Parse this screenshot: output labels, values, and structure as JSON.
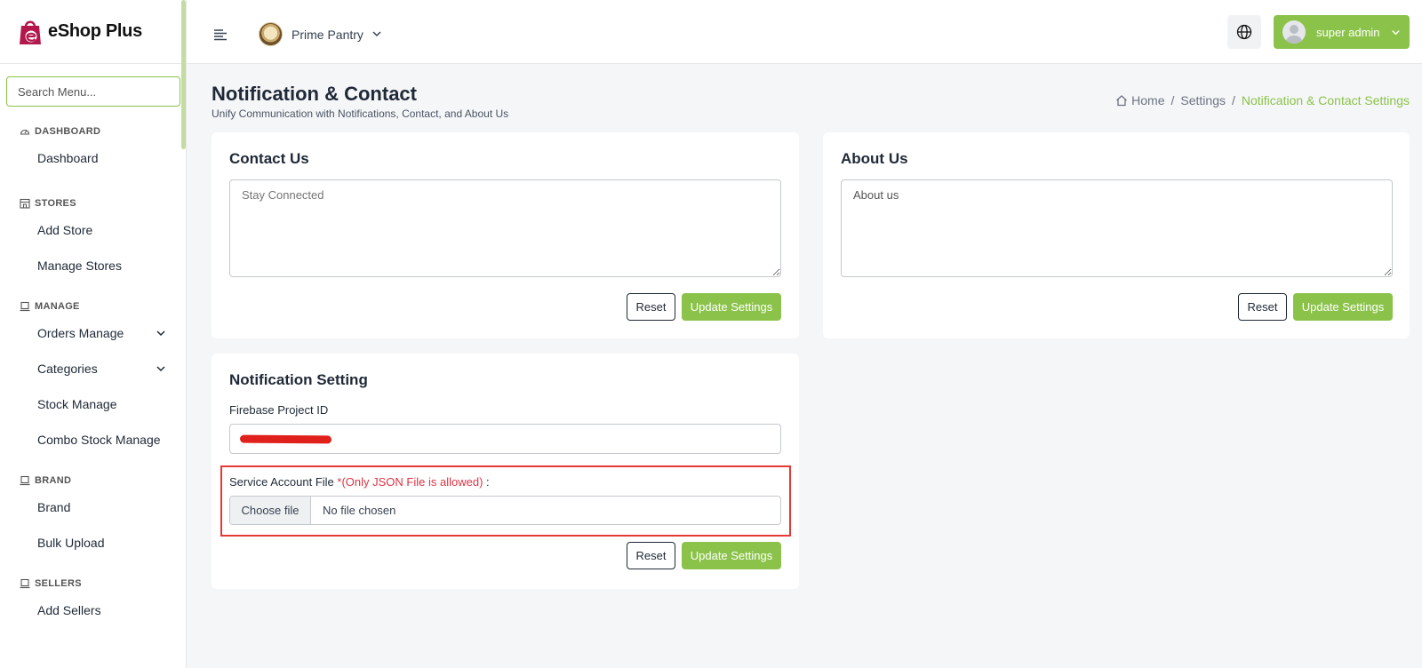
{
  "app": {
    "name": "eShop Plus"
  },
  "sidebar": {
    "search_placeholder": "Search Menu...",
    "sections": {
      "dashboard": {
        "title": "DASHBOARD",
        "items": [
          "Dashboard"
        ]
      },
      "stores": {
        "title": "STORES",
        "items": [
          "Add Store",
          "Manage Stores"
        ]
      },
      "manage": {
        "title": "MANAGE",
        "items": [
          "Orders Manage",
          "Categories",
          "Stock Manage",
          "Combo Stock Manage"
        ]
      },
      "brand": {
        "title": "BRAND",
        "items": [
          "Brand",
          "Bulk Upload"
        ]
      },
      "sellers": {
        "title": "SELLERS",
        "items": [
          "Add Sellers"
        ]
      }
    }
  },
  "topbar": {
    "store_name": "Prime Pantry",
    "user_name": "super admin"
  },
  "page": {
    "title": "Notification & Contact",
    "subtitle": "Unify Communication with Notifications, Contact, and About Us"
  },
  "breadcrumb": {
    "home": "Home",
    "settings": "Settings",
    "current": "Notification & Contact Settings"
  },
  "contact_card": {
    "title": "Contact Us",
    "placeholder": "Stay Connected",
    "reset_label": "Reset",
    "update_label": "Update Settings"
  },
  "about_card": {
    "title": "About Us",
    "value": "About us",
    "reset_label": "Reset",
    "update_label": "Update Settings"
  },
  "notification_card": {
    "title": "Notification Setting",
    "firebase_label": "Firebase Project ID",
    "service_label": "Service Account File",
    "service_note": "*(Only JSON File is allowed)",
    "service_suffix": " :",
    "choose_file": "Choose file",
    "file_status": "No file chosen",
    "reset_label": "Reset",
    "update_label": "Update Settings"
  },
  "colors": {
    "accent": "#8bc34a",
    "brand": "#c2185b",
    "required": "#dc3545"
  }
}
